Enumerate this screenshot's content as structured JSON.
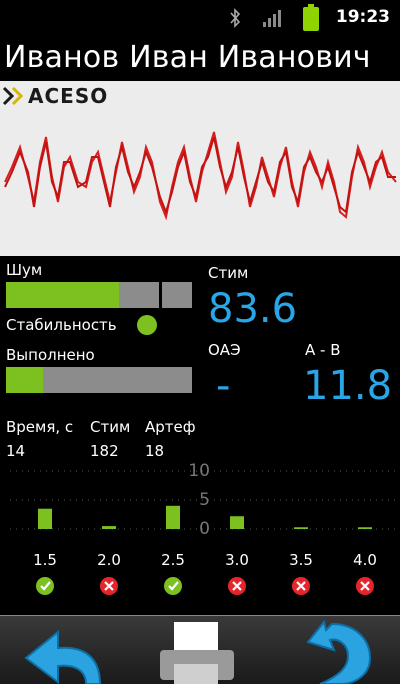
{
  "status_bar": {
    "time": "19:23",
    "icons": [
      "bluetooth-icon",
      "signal-icon",
      "battery-icon"
    ]
  },
  "patient_name": "Иванов Иван Иванович",
  "logo": {
    "text": "ACESO"
  },
  "left_panel": {
    "noise_label": "Шум",
    "noise_level": 0.61,
    "stability_label": "Стабильность",
    "stability_color": "#7cc11f",
    "done_label": "Выполнено",
    "done_progress": 0.2
  },
  "right_panel": {
    "stim_label": "Стим",
    "stim_value": "83.6",
    "oae_label": "ОАЭ",
    "oae_value": "-",
    "ab_label": "А - В",
    "ab_value": "11.8"
  },
  "stats": {
    "time_label": "Время, с",
    "time_value": "14",
    "stim_label": "Стим",
    "stim_value": "182",
    "artef_label": "Артеф",
    "artef_value": "18"
  },
  "chart_data": {
    "type": "bar",
    "categories": [
      "1.5",
      "2.0",
      "2.5",
      "3.0",
      "3.5",
      "4.0"
    ],
    "values": [
      3.5,
      0.5,
      4.0,
      2.2,
      0.3,
      0.3
    ],
    "ylim": [
      0,
      10
    ],
    "yticks": [
      "10",
      "5",
      "0"
    ],
    "statuses": [
      "pass",
      "fail",
      "pass",
      "fail",
      "fail",
      "fail"
    ],
    "colors": {
      "bar": "#7cc11f",
      "pass": "#7cc11f",
      "fail": "#e5252a"
    }
  },
  "toolbar": {
    "buttons": [
      "back-icon",
      "print-icon",
      "repeat-icon"
    ]
  }
}
